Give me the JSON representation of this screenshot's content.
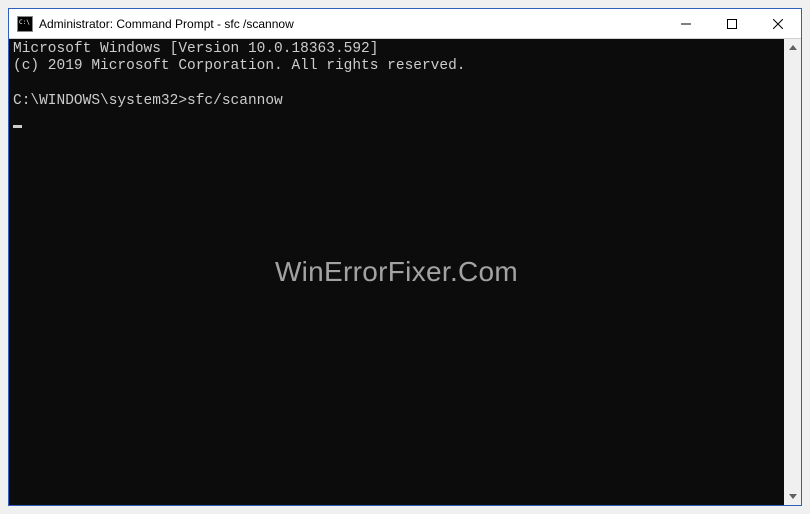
{
  "window": {
    "title": "Administrator: Command Prompt - sfc /scannow"
  },
  "console": {
    "line1": "Microsoft Windows [Version 10.0.18363.592]",
    "line2": "(c) 2019 Microsoft Corporation. All rights reserved.",
    "blank": "",
    "prompt": "C:\\WINDOWS\\system32>",
    "command": "sfc/scannow"
  },
  "watermark": "WinErrorFixer.Com"
}
